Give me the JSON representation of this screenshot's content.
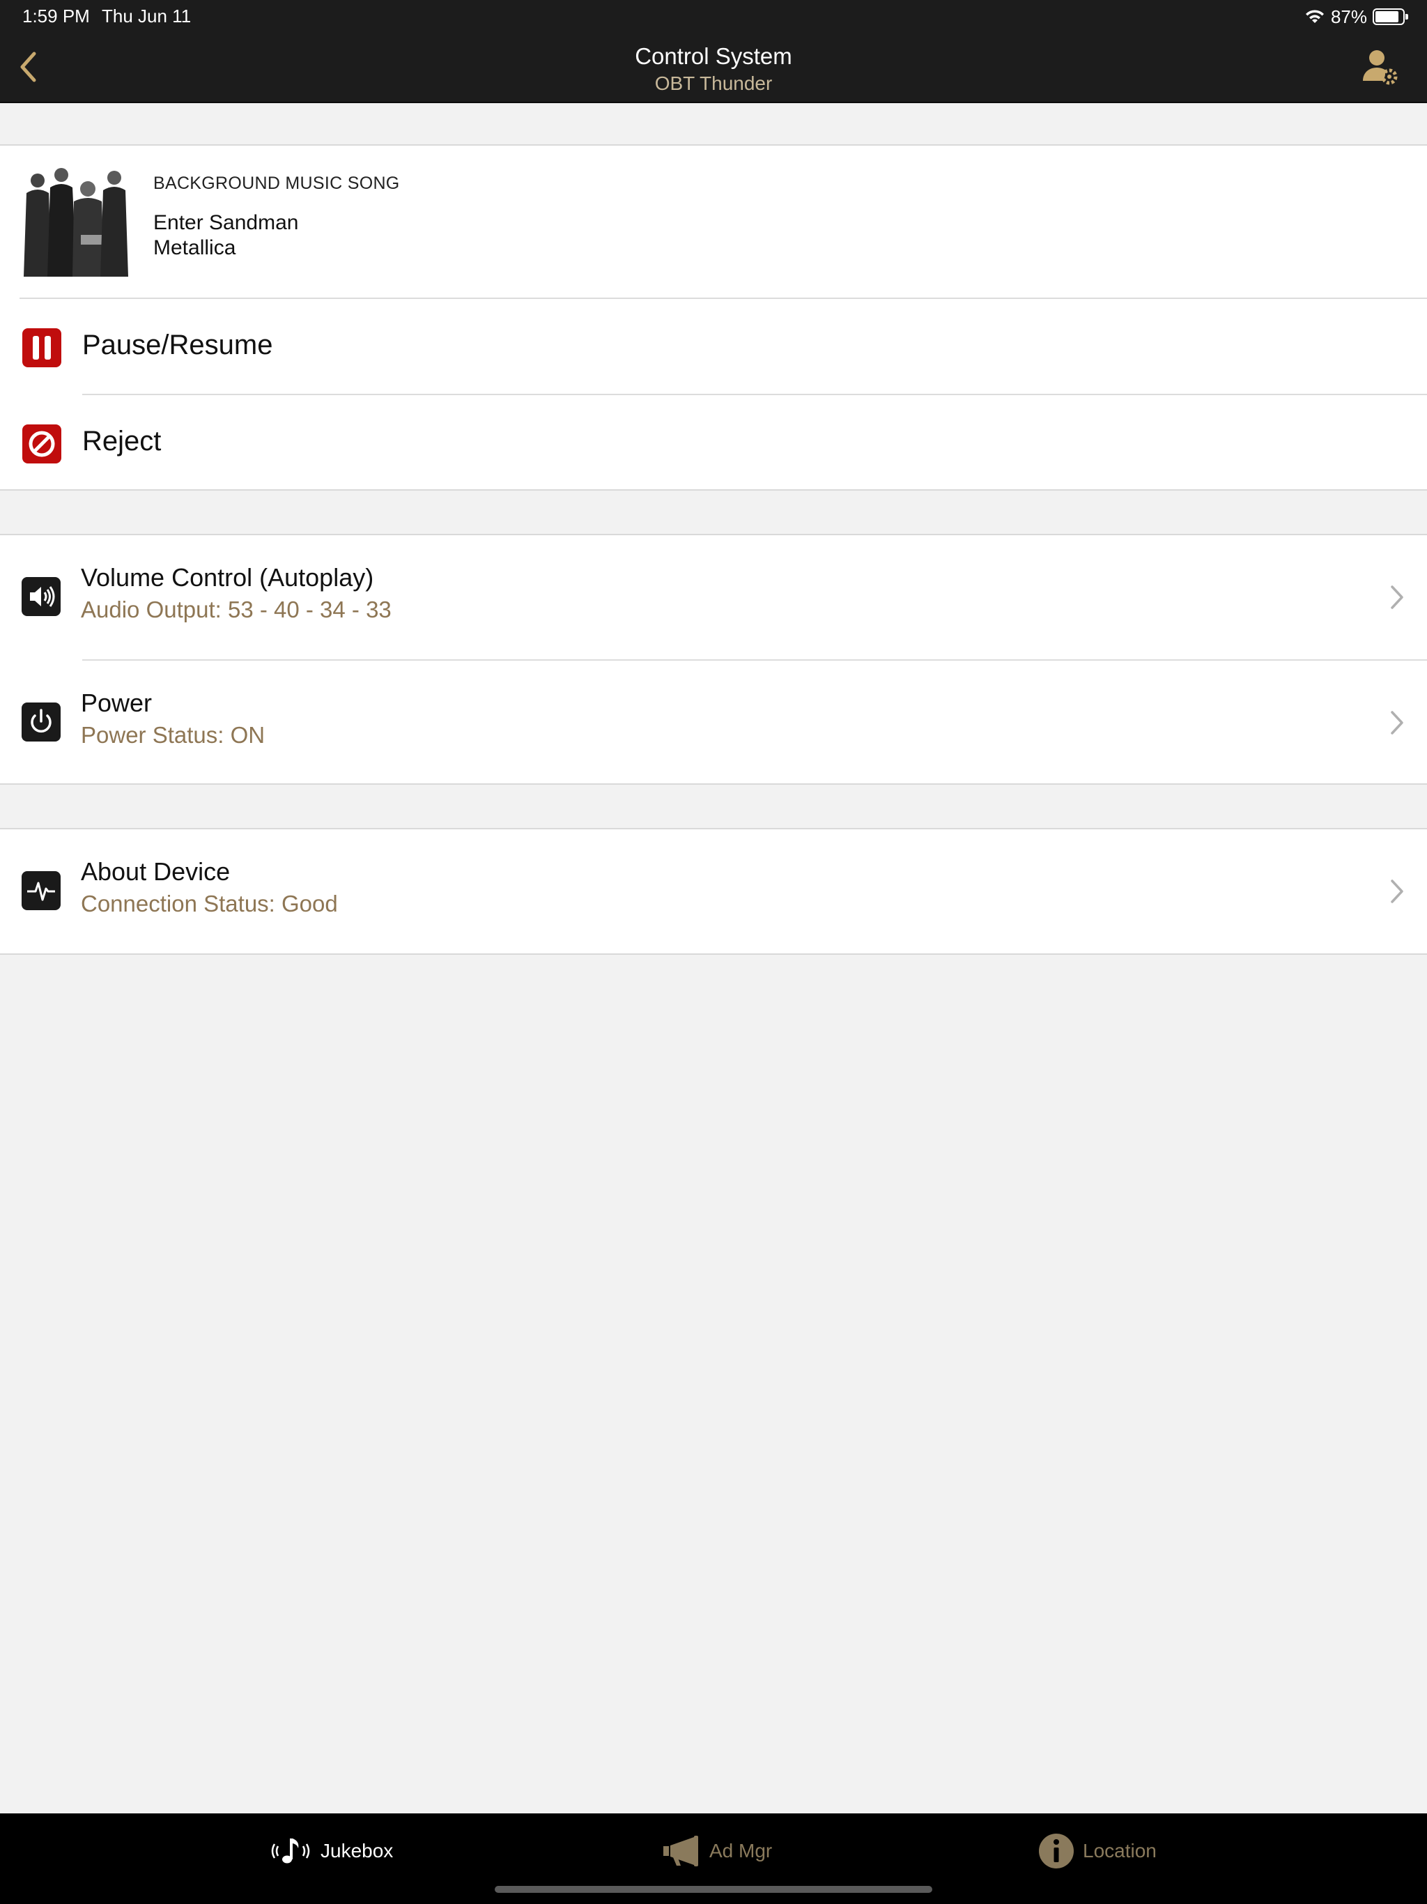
{
  "status_bar": {
    "time": "1:59 PM",
    "date": "Thu Jun 11",
    "battery": "87%",
    "battery_level": 0.87
  },
  "nav": {
    "title": "Control System",
    "subtitle": "OBT Thunder"
  },
  "now_playing": {
    "label": "BACKGROUND MUSIC SONG",
    "song": "Enter Sandman",
    "artist": "Metallica"
  },
  "actions": [
    {
      "label": "Pause/Resume",
      "icon": "pause-icon"
    },
    {
      "label": "Reject",
      "icon": "block-icon"
    }
  ],
  "settings": [
    {
      "label": "Volume Control (Autoplay)",
      "detail": "Audio Output: 53 - 40 - 34 - 33",
      "icon": "speaker-icon"
    },
    {
      "label": "Power",
      "detail": "Power Status: ON",
      "icon": "power-icon"
    }
  ],
  "device": {
    "label": "About Device",
    "detail": "Connection Status: Good",
    "icon": "pulse-icon"
  },
  "tabs": [
    {
      "label": "Jukebox",
      "icon": "jukebox-icon",
      "selected": true
    },
    {
      "label": "Ad Mgr",
      "icon": "megaphone-icon",
      "selected": false
    },
    {
      "label": "Location",
      "icon": "info-icon",
      "selected": false
    }
  ],
  "colors": {
    "accent": "#c8a96e",
    "detail_text": "#8e7654",
    "action_red": "#c00d0d",
    "topbar": "#1c1c1c",
    "tab_inactive": "#8a7a5c"
  }
}
